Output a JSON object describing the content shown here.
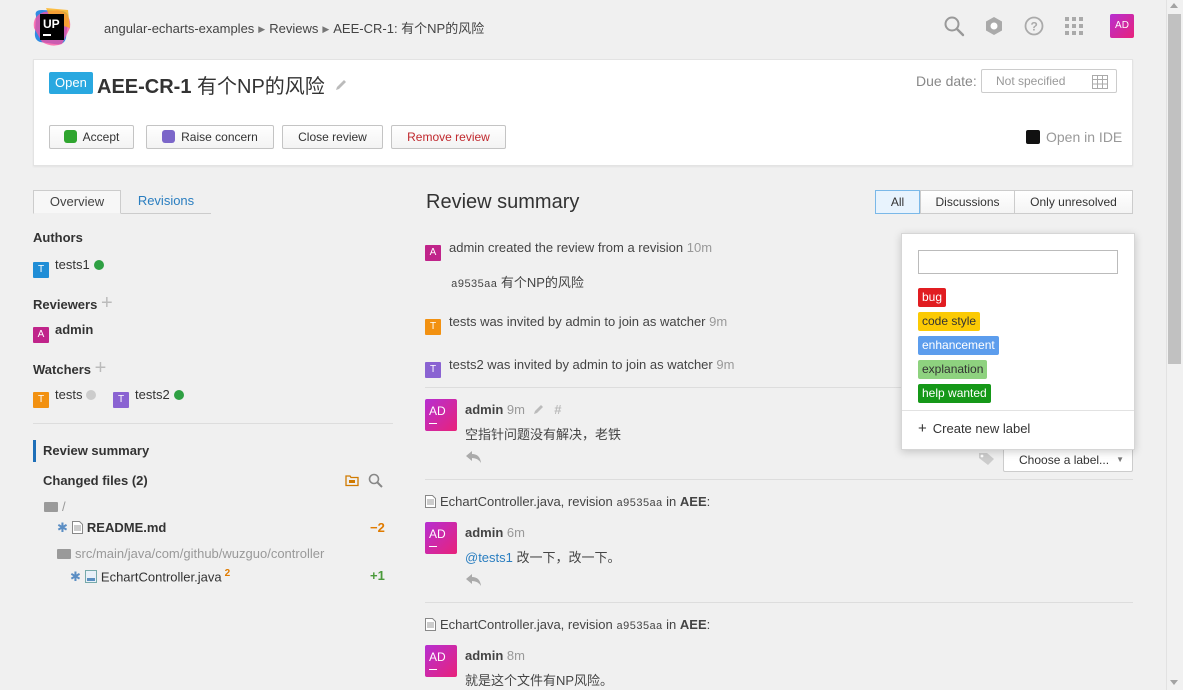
{
  "app": {
    "logo_text": "UP",
    "breadcrumb": [
      "angular-echarts-examples",
      "Reviews",
      "AEE-CR-1: 有个NP的风险"
    ],
    "user_initials": "AD"
  },
  "review": {
    "status": "Open",
    "id": "AEE-CR-1",
    "title": "有个NP的风险",
    "due_label": "Due date:",
    "due_value": "Not specified",
    "actions": {
      "accept": "Accept",
      "raise_concern": "Raise concern",
      "close_review": "Close review",
      "remove_review": "Remove review",
      "open_in_ide": "Open in IDE"
    }
  },
  "sidebar": {
    "tabs": {
      "overview": "Overview",
      "revisions": "Revisions"
    },
    "authors_heading": "Authors",
    "authors": [
      {
        "initial": "T",
        "name": "tests1",
        "color": "#1f8dd6",
        "status_color": "#2ea043"
      }
    ],
    "reviewers_heading": "Reviewers",
    "reviewers": [
      {
        "initial": "A",
        "name": "admin",
        "color": "#c0248a"
      }
    ],
    "watchers_heading": "Watchers",
    "watchers": [
      {
        "initial": "T",
        "name": "tests",
        "color": "#f29111",
        "status_color": "#cccccc"
      },
      {
        "initial": "T",
        "name": "tests2",
        "color": "#8a63d2",
        "status_color": "#2ea043"
      }
    ],
    "nav_summary": "Review summary",
    "changed_files_heading": "Changed files (2)",
    "tree": {
      "root": "/",
      "file1": {
        "name": "README.md",
        "delta": "−2"
      },
      "folder2": "src/main/java/com/github/wuzguo/controller",
      "file2": {
        "name": "EchartController.java",
        "sup": "2",
        "delta": "+1"
      }
    }
  },
  "main": {
    "title": "Review summary",
    "filters": {
      "all": "All",
      "discussions": "Discussions",
      "unresolved": "Only unresolved"
    },
    "events": [
      {
        "initial": "A",
        "color": "#c0248a",
        "text": "admin created the review from a revision",
        "time": "10m",
        "rev": "a9535aa",
        "rev_title": "有个NP的风险"
      },
      {
        "initial": "T",
        "color": "#f29111",
        "text": "tests was invited by admin to join as watcher",
        "time": "9m"
      },
      {
        "initial": "T",
        "color": "#8a63d2",
        "text": "tests2 was invited by admin to join as watcher",
        "time": "9m"
      }
    ],
    "comment1": {
      "avatar": "AD",
      "author": "admin",
      "time": "9m",
      "text": "空指针问题没有解决，老铁"
    },
    "choose_label": "Choose a label...",
    "file_comment_1": {
      "file": "EchartController.java, revision",
      "rev": "a9535aa",
      "in": "in",
      "project": "AEE",
      "colon": ":",
      "avatar": "AD",
      "author": "admin",
      "time": "6m",
      "mention": "@tests1",
      "text": " 改一下，改一下。"
    },
    "file_comment_2": {
      "file": "EchartController.java, revision",
      "rev": "a9535aa",
      "in": "in",
      "project": "AEE",
      "colon": ":",
      "avatar": "AD",
      "author": "admin",
      "time": "8m",
      "text": "就是这个文件有NP风险。"
    }
  },
  "label_dropdown": {
    "labels": [
      {
        "name": "bug",
        "bg": "#e11d21",
        "fg": "#ffffff"
      },
      {
        "name": "code style",
        "bg": "#fbca04",
        "fg": "#333333"
      },
      {
        "name": "enhancement",
        "bg": "#5c9ded",
        "fg": "#ffffff"
      },
      {
        "name": "explanation",
        "bg": "#8ed27f",
        "fg": "#333333"
      },
      {
        "name": "help wanted",
        "bg": "#159818",
        "fg": "#ffffff"
      }
    ],
    "create_new": "Create new label"
  }
}
